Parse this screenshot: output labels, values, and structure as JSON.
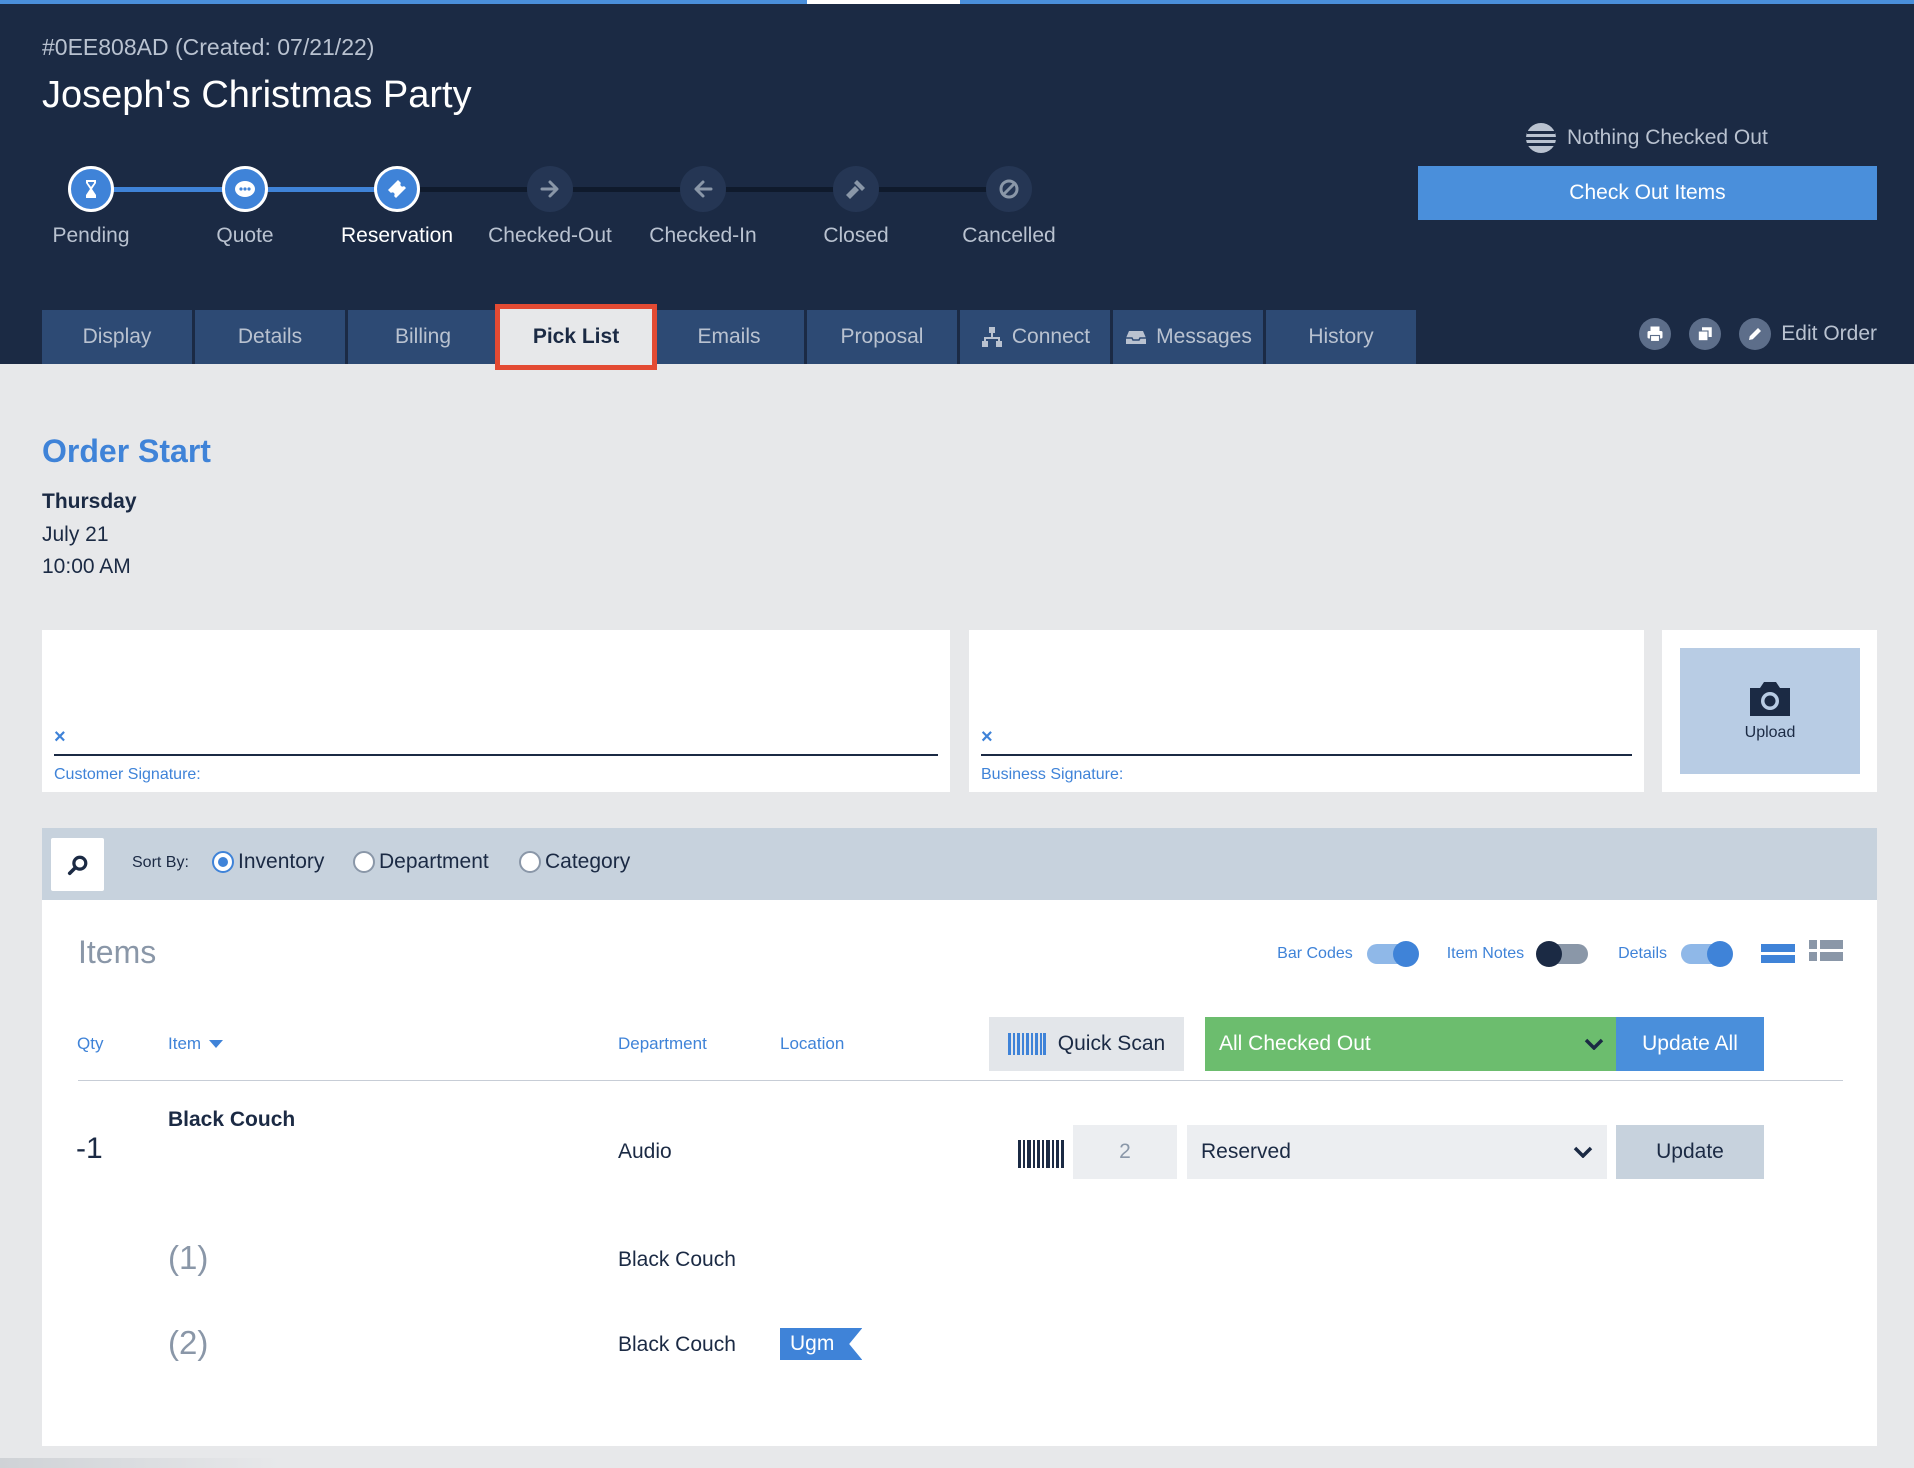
{
  "order": {
    "id": "#0EE808AD (Created: 07/21/22)",
    "title": "Joseph's Christmas Party"
  },
  "steps": [
    {
      "label": "Pending",
      "icon": "hourglass-icon",
      "state": "done"
    },
    {
      "label": "Quote",
      "icon": "chat-bubble-icon",
      "state": "done"
    },
    {
      "label": "Reservation",
      "icon": "ticket-icon",
      "state": "current"
    },
    {
      "label": "Checked-Out",
      "icon": "arrow-right-icon",
      "state": "todo"
    },
    {
      "label": "Checked-In",
      "icon": "arrow-left-icon",
      "state": "todo"
    },
    {
      "label": "Closed",
      "icon": "gavel-icon",
      "state": "todo"
    },
    {
      "label": "Cancelled",
      "icon": "ban-icon",
      "state": "todo"
    }
  ],
  "checkout": {
    "status": "Nothing Checked Out",
    "button": "Check Out Items"
  },
  "tabs": [
    {
      "label": "Display"
    },
    {
      "label": "Details"
    },
    {
      "label": "Billing"
    },
    {
      "label": "Pick List",
      "active": true
    },
    {
      "label": "Emails"
    },
    {
      "label": "Proposal"
    },
    {
      "label": "Connect",
      "icon": "connect-icon"
    },
    {
      "label": "Messages",
      "icon": "inbox-icon"
    },
    {
      "label": "History"
    }
  ],
  "header_actions": {
    "edit_order": "Edit Order"
  },
  "order_start": {
    "title": "Order Start",
    "day": "Thursday",
    "date": "July 21",
    "time": "10:00 AM"
  },
  "signatures": {
    "x_mark": "×",
    "customer_label": "Customer Signature:",
    "business_label": "Business Signature:",
    "upload_label": "Upload"
  },
  "sort": {
    "label": "Sort By:",
    "options": [
      "Inventory",
      "Department",
      "Category"
    ],
    "selected": "Inventory"
  },
  "items": {
    "title": "Items",
    "toggles": [
      {
        "label": "Bar Codes",
        "on": true
      },
      {
        "label": "Item Notes",
        "on": false
      },
      {
        "label": "Details",
        "on": true
      }
    ],
    "columns": {
      "qty": "Qty",
      "item": "Item",
      "department": "Department",
      "location": "Location"
    },
    "quick_scan": "Quick Scan",
    "bulk_status": "All Checked Out",
    "update_all": "Update All",
    "rows": [
      {
        "qty": "-1",
        "name": "Black Couch",
        "department": "Audio",
        "scan_qty": "2",
        "status": "Reserved",
        "update": "Update",
        "serials": [
          {
            "index": "(1)",
            "name": "Black Couch",
            "tag": ""
          },
          {
            "index": "(2)",
            "name": "Black Couch",
            "tag": "Ugm"
          }
        ]
      }
    ]
  },
  "colors": {
    "header_bg": "#1b2a44",
    "accent": "#4a8fdb",
    "highlight_border": "#e34a33",
    "checked_out_green": "#6cbd6e"
  }
}
